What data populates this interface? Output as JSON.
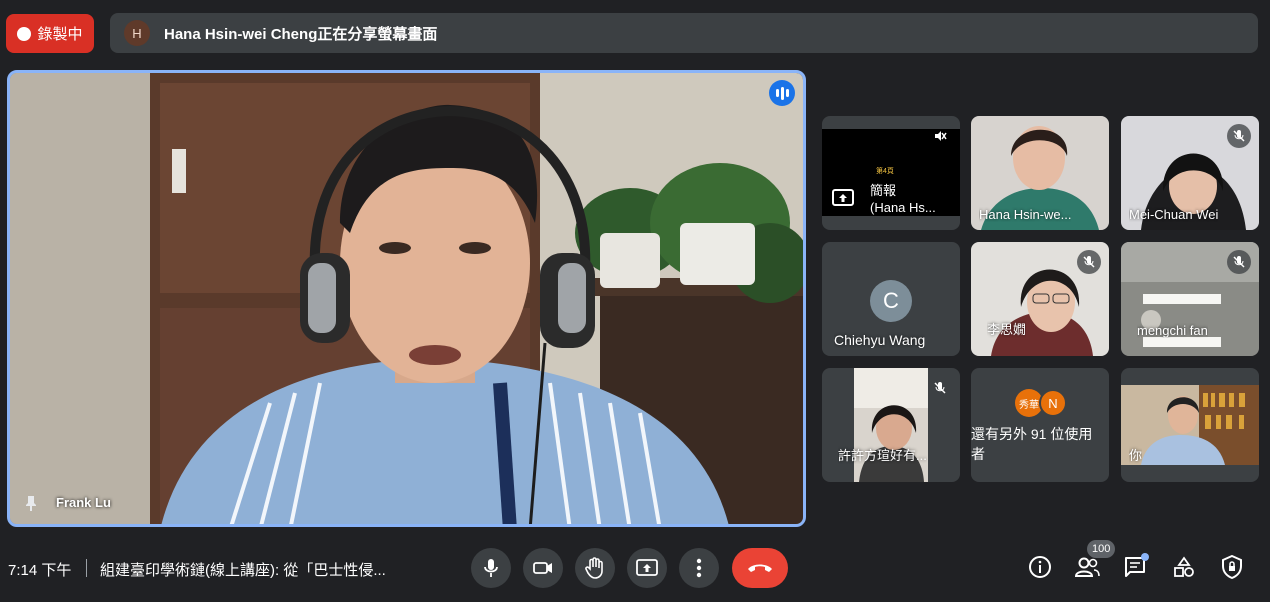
{
  "top": {
    "recording_label": "錄製中",
    "presenter_initial": "H",
    "presenting_text": "Hana Hsin-wei Cheng正在分享螢幕畫面"
  },
  "main": {
    "speaker_name": "Frank Lu"
  },
  "tiles": {
    "t1": {
      "small_text": "第4頁",
      "line1": "簡報",
      "line2": "(Hana Hs..."
    },
    "t2": {
      "name": "Hana Hsin-we..."
    },
    "t3": {
      "name": "Mei-Chuan Wei"
    },
    "t4": {
      "initial": "C",
      "name": "Chiehyu Wang"
    },
    "t5": {
      "name": "李思嫺"
    },
    "t6": {
      "name": "mengchi fan"
    },
    "t7": {
      "name": "許許方瑄好有..."
    },
    "t8": {
      "avatar1": "秀華",
      "avatar2": "N",
      "text": "還有另外 91 位使用者"
    },
    "t9": {
      "name": "你"
    }
  },
  "bottom": {
    "time": "7:14 下午",
    "meeting_title": "組建臺印學術鏈(線上講座): 從「巴士性侵...",
    "participant_count": "100"
  },
  "colors": {
    "accent": "#8ab4f8",
    "record": "#d93025",
    "hangup": "#ea4335",
    "background": "#202124",
    "tile": "#3c4043"
  },
  "icons": [
    "microphone-icon",
    "camera-icon",
    "raise-hand-icon",
    "present-screen-icon",
    "more-options-icon",
    "hang-up-icon",
    "info-icon",
    "people-icon",
    "chat-icon",
    "activities-icon",
    "host-controls-icon"
  ]
}
